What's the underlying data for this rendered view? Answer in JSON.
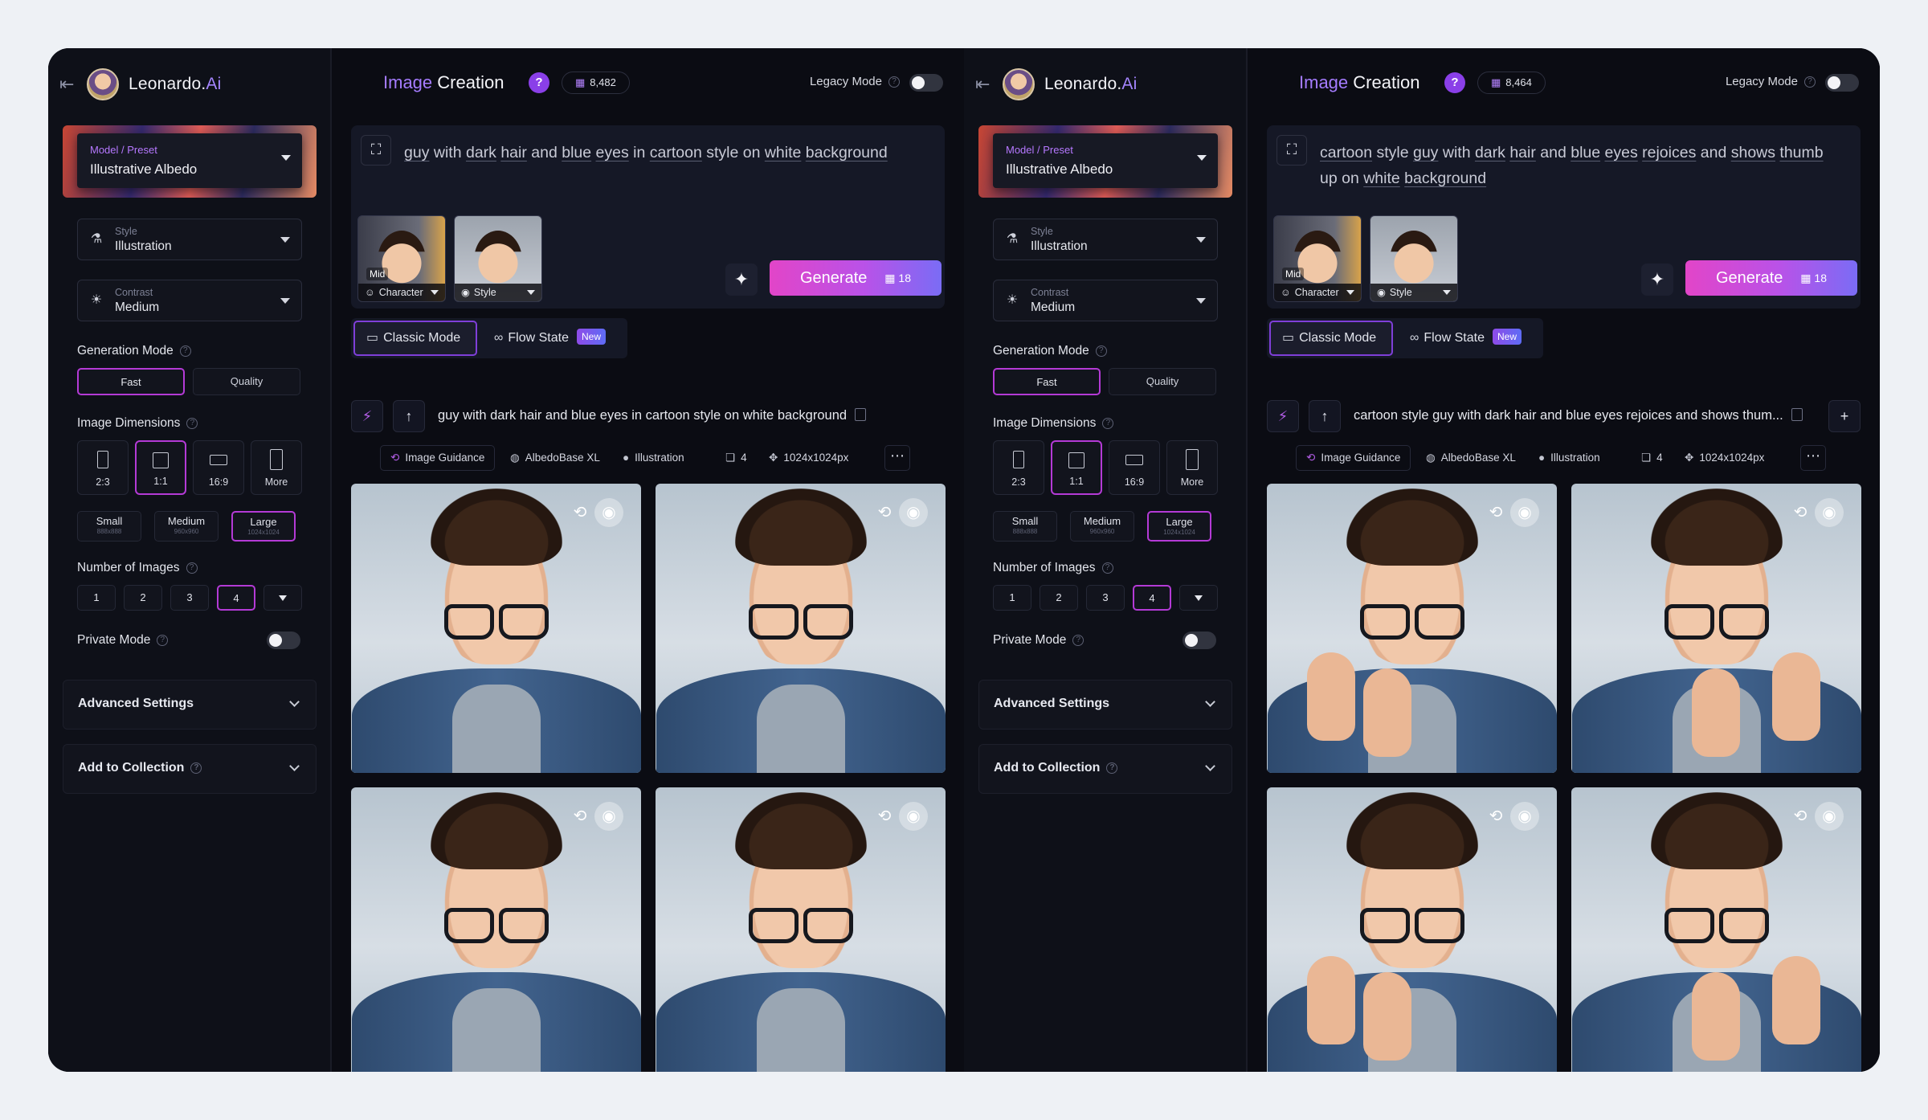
{
  "panels": [
    {
      "brand": {
        "name": "Leonardo.",
        "suffix": "Ai"
      },
      "preset": {
        "label": "Model / Preset",
        "value": "Illustrative Albedo"
      },
      "style": {
        "label": "Style",
        "value": "Illustration"
      },
      "contrast": {
        "label": "Contrast",
        "value": "Medium"
      },
      "generation_mode": {
        "title": "Generation Mode",
        "options": [
          "Fast",
          "Quality"
        ],
        "selected": "Fast"
      },
      "image_dimensions": {
        "title": "Image Dimensions",
        "ratios": [
          "2:3",
          "1:1",
          "16:9",
          "More"
        ],
        "selected_ratio": "1:1",
        "sizes": [
          {
            "label": "Small",
            "sub": "888x888"
          },
          {
            "label": "Medium",
            "sub": "960x960"
          },
          {
            "label": "Large",
            "sub": "1024x1024"
          }
        ],
        "selected_size": "Large"
      },
      "number_of_images": {
        "title": "Number of Images",
        "options": [
          "1",
          "2",
          "3",
          "4"
        ],
        "selected": "4"
      },
      "private_mode": {
        "label": "Private Mode",
        "enabled": false
      },
      "advanced_settings": "Advanced Settings",
      "add_to_collection": "Add to Collection",
      "header": {
        "title_part1": "Image",
        "title_part2": " Creation",
        "help": "?",
        "tokens": "8,482",
        "legacy_label": "Legacy Mode",
        "legacy_enabled": false
      },
      "prompt_words": [
        "guy",
        " with ",
        "dark",
        " ",
        "hair",
        " and ",
        "blue",
        " ",
        "eyes",
        " in ",
        "cartoon",
        " style on ",
        "white",
        " ",
        "background"
      ],
      "underlined": [
        true,
        false,
        true,
        false,
        true,
        false,
        true,
        false,
        true,
        false,
        true,
        false,
        true,
        false,
        true
      ],
      "references": [
        {
          "tag": "Character",
          "badge": "Mid"
        },
        {
          "tag": "Style"
        }
      ],
      "generate": {
        "label": "Generate",
        "cost": "18"
      },
      "tabs": {
        "classic": "Classic Mode",
        "flow": "Flow State",
        "new_badge": "New"
      },
      "result_prompt": "guy with dark hair and blue eyes in cartoon style on white background",
      "meta": {
        "guidance": "Image Guidance",
        "model": "AlbedoBase XL",
        "style": "Illustration",
        "count": "4",
        "size": "1024x1024px"
      },
      "images": [
        {
          "pose": "portrait"
        },
        {
          "pose": "portrait"
        },
        {
          "pose": "portrait"
        },
        {
          "pose": "portrait"
        }
      ]
    },
    {
      "brand": {
        "name": "Leonardo.",
        "suffix": "Ai"
      },
      "preset": {
        "label": "Model / Preset",
        "value": "Illustrative Albedo"
      },
      "style": {
        "label": "Style",
        "value": "Illustration"
      },
      "contrast": {
        "label": "Contrast",
        "value": "Medium"
      },
      "generation_mode": {
        "title": "Generation Mode",
        "options": [
          "Fast",
          "Quality"
        ],
        "selected": "Fast"
      },
      "image_dimensions": {
        "title": "Image Dimensions",
        "ratios": [
          "2:3",
          "1:1",
          "16:9",
          "More"
        ],
        "selected_ratio": "1:1",
        "sizes": [
          {
            "label": "Small",
            "sub": "888x888"
          },
          {
            "label": "Medium",
            "sub": "960x960"
          },
          {
            "label": "Large",
            "sub": "1024x1024"
          }
        ],
        "selected_size": "Large"
      },
      "number_of_images": {
        "title": "Number of Images",
        "options": [
          "1",
          "2",
          "3",
          "4"
        ],
        "selected": "4"
      },
      "private_mode": {
        "label": "Private Mode",
        "enabled": false
      },
      "advanced_settings": "Advanced Settings",
      "add_to_collection": "Add to Collection",
      "header": {
        "title_part1": "Image",
        "title_part2": " Creation",
        "help": "?",
        "tokens": "8,464",
        "legacy_label": "Legacy Mode",
        "legacy_enabled": false
      },
      "prompt_words": [
        "cartoon",
        " style ",
        "guy",
        " with ",
        "dark",
        " ",
        "hair",
        " and ",
        "blue",
        " ",
        "eyes",
        " ",
        "rejoices",
        " and ",
        "shows",
        " ",
        "thumb",
        " up on ",
        "white",
        " ",
        "background"
      ],
      "underlined": [
        true,
        false,
        true,
        false,
        true,
        false,
        true,
        false,
        true,
        false,
        true,
        false,
        true,
        false,
        true,
        false,
        true,
        false,
        true,
        false,
        true
      ],
      "references": [
        {
          "tag": "Character",
          "badge": "Mid"
        },
        {
          "tag": "Style"
        }
      ],
      "generate": {
        "label": "Generate",
        "cost": "18"
      },
      "tabs": {
        "classic": "Classic Mode",
        "flow": "Flow State",
        "new_badge": "New"
      },
      "result_prompt": "cartoon style guy with dark hair and blue eyes rejoices and shows thum...",
      "meta": {
        "guidance": "Image Guidance",
        "model": "AlbedoBase XL",
        "style": "Illustration",
        "count": "4",
        "size": "1024x1024px"
      },
      "images": [
        {
          "pose": "thumbs-up"
        },
        {
          "pose": "thumbs-up"
        },
        {
          "pose": "thumbs-up"
        },
        {
          "pose": "thumbs-up"
        }
      ]
    }
  ],
  "colors": {
    "accent": "#b43ad6",
    "brand_ai": "#a585ff",
    "background": "#0d0f17"
  }
}
